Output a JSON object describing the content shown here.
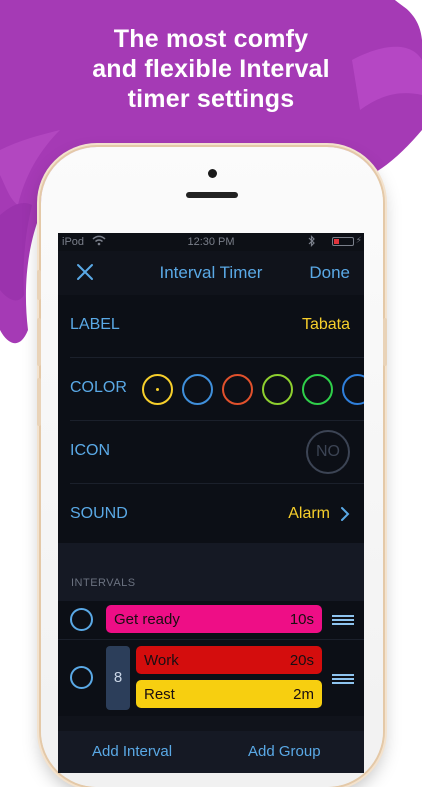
{
  "headline": {
    "line1": "The most comfy",
    "line2": "and flexible Interval",
    "line3": "timer settings"
  },
  "colors": {
    "splash": "#a53ab5",
    "accent": "#5aa9e6",
    "value": "#f7cf2b",
    "screen_bg": "#10131b"
  },
  "status_bar": {
    "carrier": "iPod",
    "wifi_icon": "wifi-icon",
    "time": "12:30 PM",
    "bluetooth_icon": "bluetooth-icon",
    "battery_icon": "battery-icon"
  },
  "nav": {
    "close_icon": "close-icon",
    "title": "Interval Timer",
    "done": "Done"
  },
  "settings": {
    "label": {
      "title": "LABEL",
      "value": "Tabata"
    },
    "color": {
      "title": "COLOR",
      "swatches": [
        "#f7cf2b",
        "#3f8fdb",
        "#e1512c",
        "#8ed02f",
        "#2fcf4a",
        "#2f7fdb"
      ],
      "selected_index": 0
    },
    "icon": {
      "title": "ICON",
      "value": "NO"
    },
    "sound": {
      "title": "SOUND",
      "value": "Alarm",
      "chevron_icon": "chevron-right-icon"
    }
  },
  "intervals": {
    "header": "INTERVALS",
    "items": [
      {
        "name": "Get ready",
        "duration": "10s",
        "color": "#ee0e86"
      }
    ],
    "group": {
      "repeat": "8",
      "items": [
        {
          "name": "Work",
          "duration": "20s",
          "color": "#d40d0d"
        },
        {
          "name": "Rest",
          "duration": "2m",
          "color": "#f7cf10"
        }
      ]
    },
    "add_interval": "Add Interval",
    "add_group": "Add Group"
  }
}
